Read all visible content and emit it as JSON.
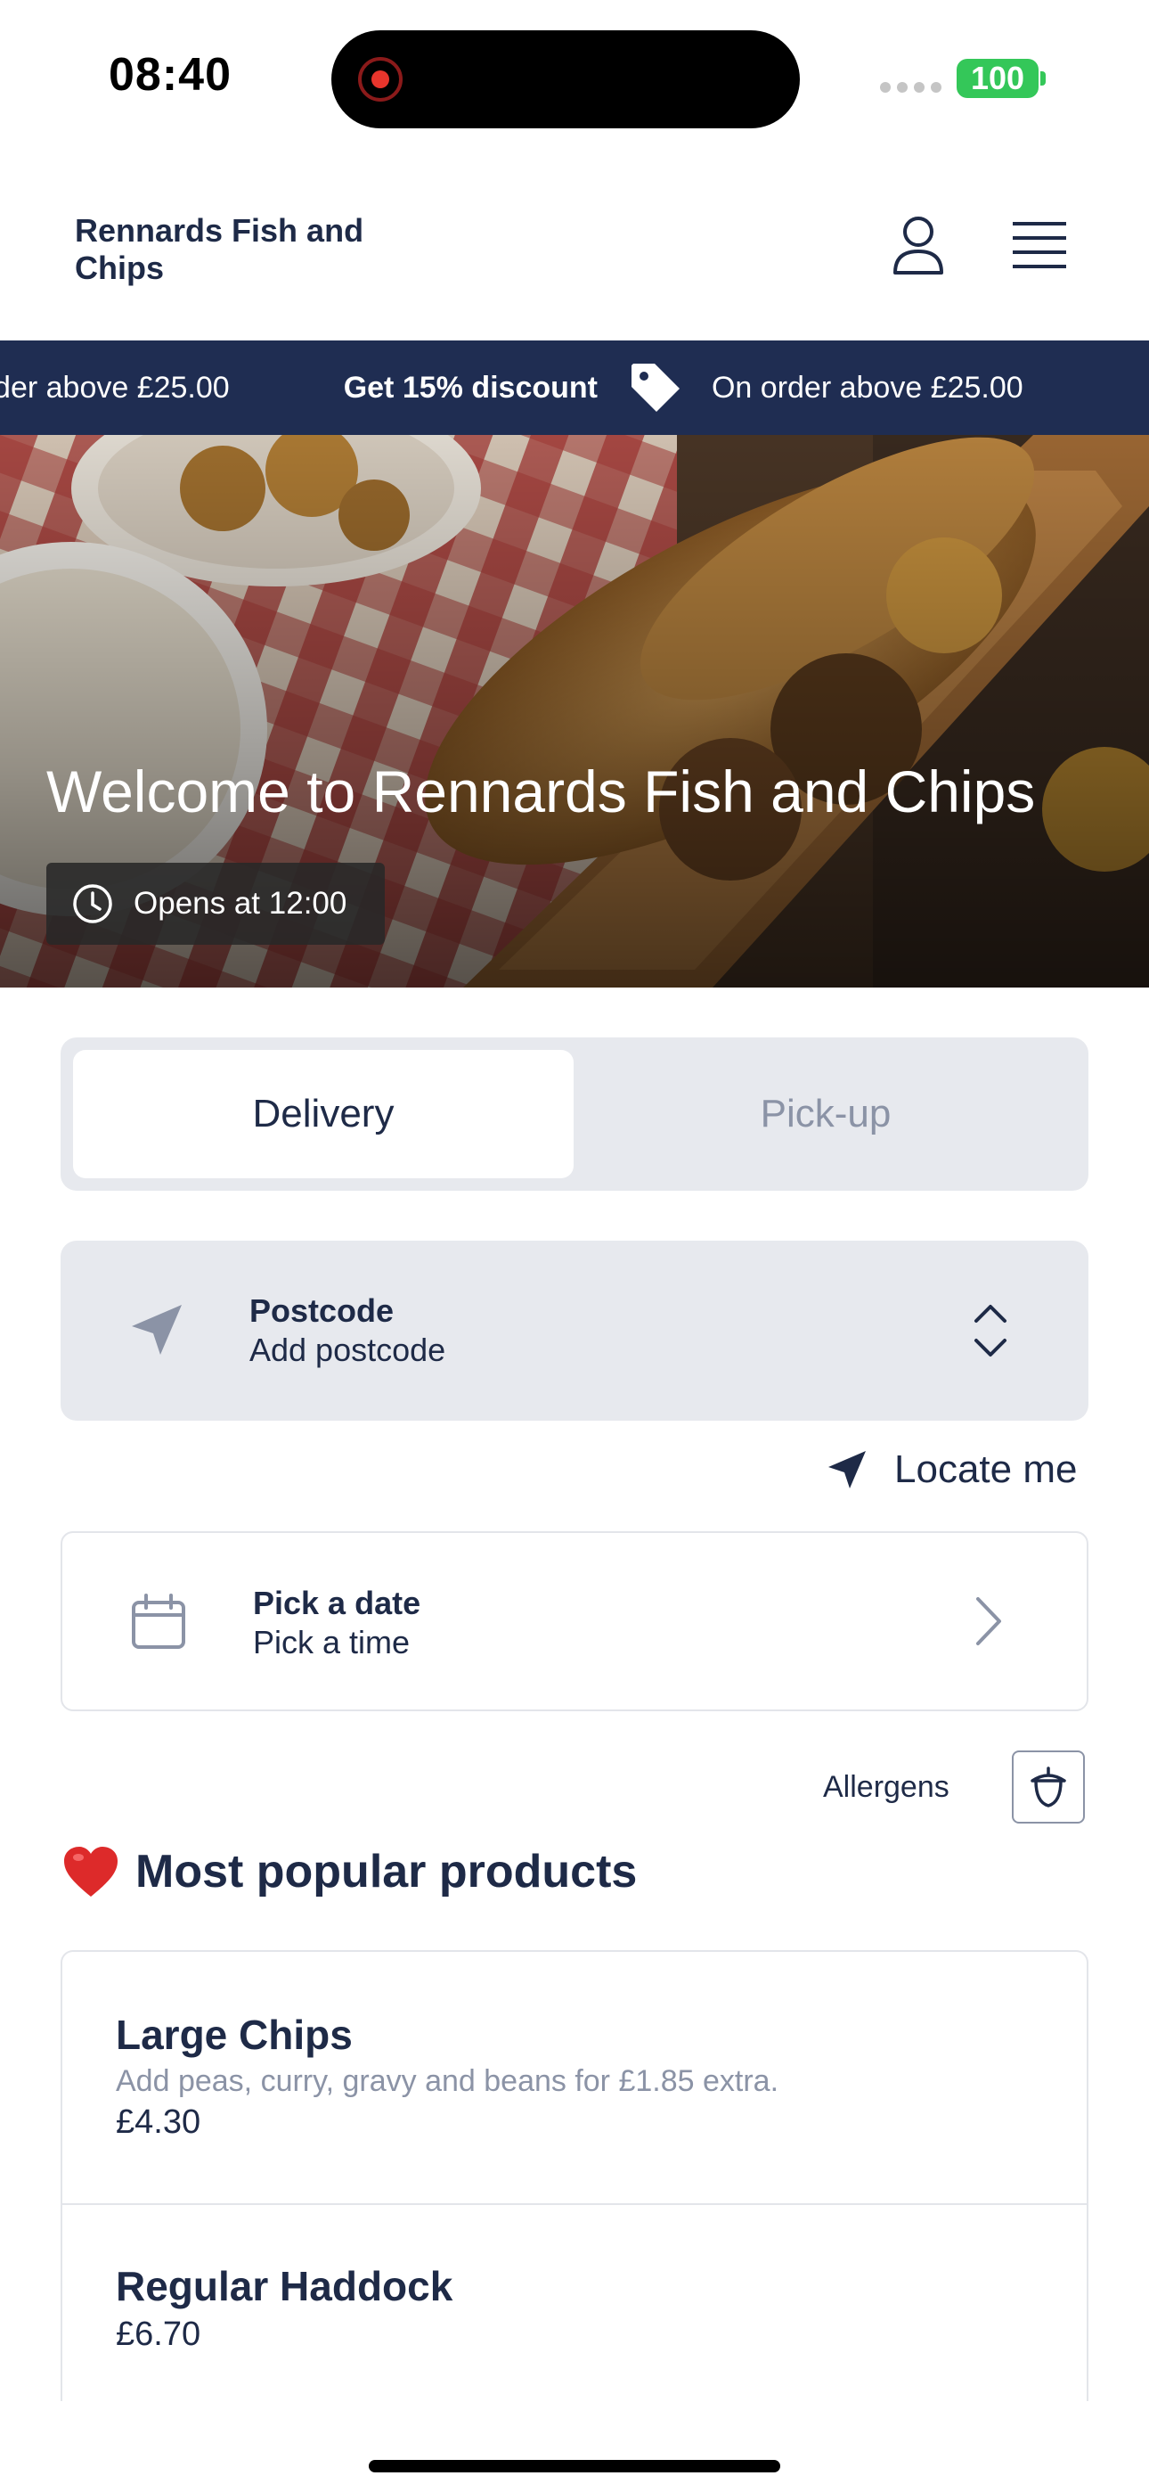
{
  "status_bar": {
    "time": "08:40",
    "battery": "100"
  },
  "header": {
    "brand": "Rennards Fish and Chips"
  },
  "promo": {
    "items": [
      {
        "text": "On order above £25.00",
        "bold": false
      },
      {
        "text": "Get 15% discount",
        "bold": true
      },
      {
        "text": "On order above £25.00",
        "bold": false
      }
    ]
  },
  "hero": {
    "title": "Welcome to Rennards Fish and Chips",
    "opening": "Opens at 12:00"
  },
  "order_type": {
    "options": [
      "Delivery",
      "Pick-up"
    ],
    "selected": "Delivery"
  },
  "postcode": {
    "label": "Postcode",
    "value": "Add postcode"
  },
  "locate": {
    "label": "Locate me"
  },
  "schedule": {
    "label": "Pick a date",
    "value": "Pick a time"
  },
  "allergens": {
    "label": "Allergens"
  },
  "popular": {
    "title": "Most popular products",
    "products": [
      {
        "name": "Large Chips",
        "description": "Add peas, curry, gravy and beans for £1.85 extra.",
        "price": "£4.30"
      },
      {
        "name": "Regular Haddock",
        "description": "",
        "price": "£6.70"
      }
    ]
  },
  "colors": {
    "primary": "#1f2d52",
    "muted": "#8b93a6",
    "surface": "#e7e9ee",
    "battery": "#34c759"
  }
}
